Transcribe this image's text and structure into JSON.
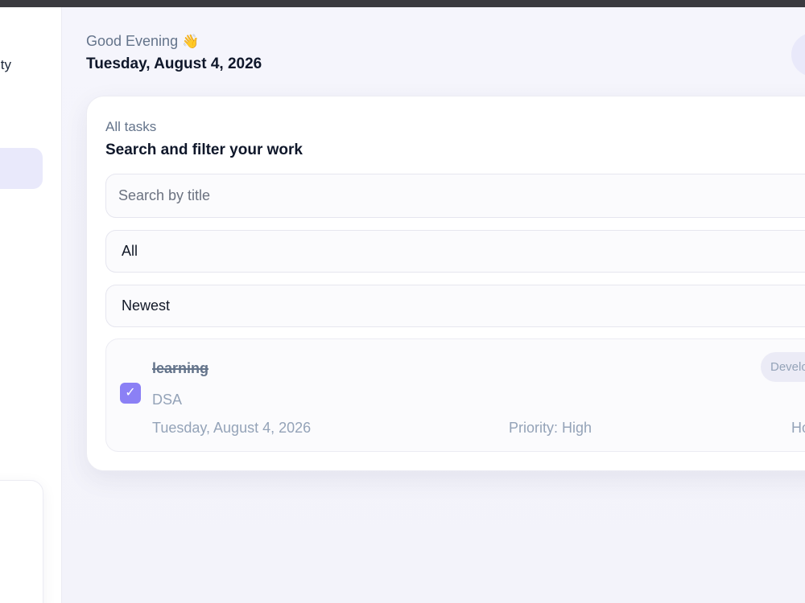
{
  "sidebar": {
    "brand_text": "ty"
  },
  "header": {
    "greeting": "Good Evening",
    "greeting_emoji": "👋",
    "date": "Tuesday, August 4, 2026"
  },
  "task_panel": {
    "eyebrow": "All tasks",
    "title": "Search and filter your work",
    "search": {
      "placeholder": "Search by title",
      "value": ""
    },
    "filter": {
      "selected": "All"
    },
    "sort": {
      "selected": "Newest"
    }
  },
  "tasks": [
    {
      "title": "learning",
      "description": "DSA",
      "date": "Tuesday, August 4, 2026",
      "priority": "Priority: High",
      "trailing_text": "Ho",
      "category": "Develo",
      "completed": true,
      "check_glyph": "✓"
    }
  ],
  "colors": {
    "accent": "#8b80f5",
    "badge_bg": "#ebebf6",
    "page_bg": "#f4f4fb",
    "avatar_bg": "#e9e9fa"
  }
}
